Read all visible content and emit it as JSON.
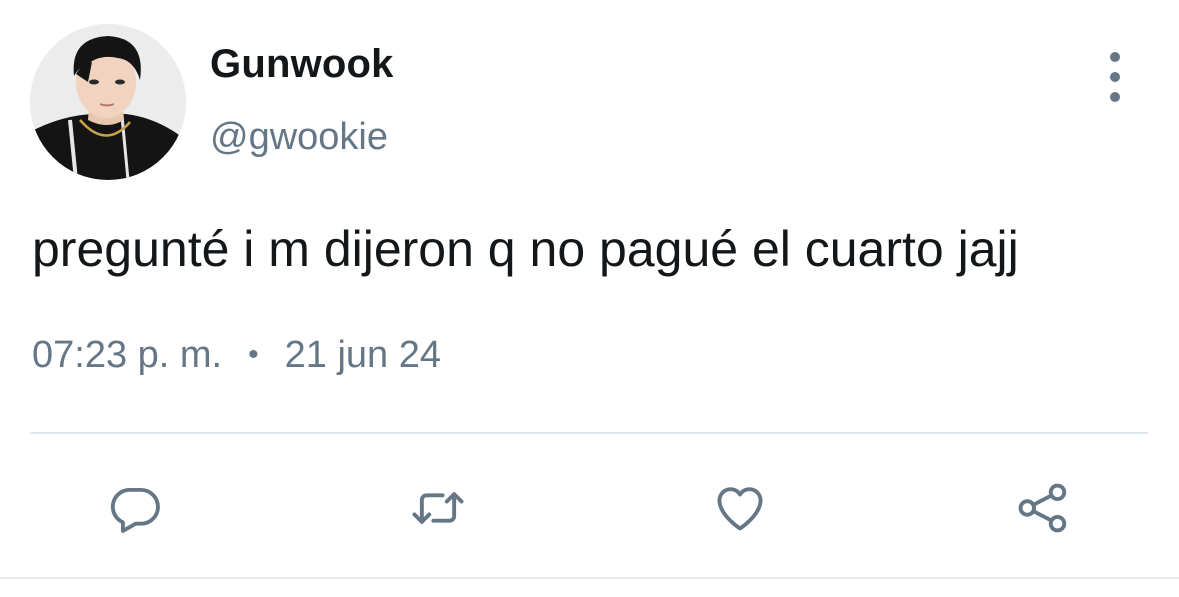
{
  "user": {
    "display_name": "Gunwook",
    "handle": "@gwookie"
  },
  "tweet": {
    "text": "pregunté i m dijeron q no pagué el cuarto jajj",
    "time": "07:23 p. m.",
    "separator": "•",
    "date": "21 jun 24"
  },
  "icons": {
    "more": "more-vertical-icon",
    "reply": "reply-icon",
    "retweet": "retweet-icon",
    "like": "heart-icon",
    "share": "share-icon"
  },
  "colors": {
    "text": "#14171a",
    "secondary": "#657786",
    "divider": "#e1e8ed"
  }
}
